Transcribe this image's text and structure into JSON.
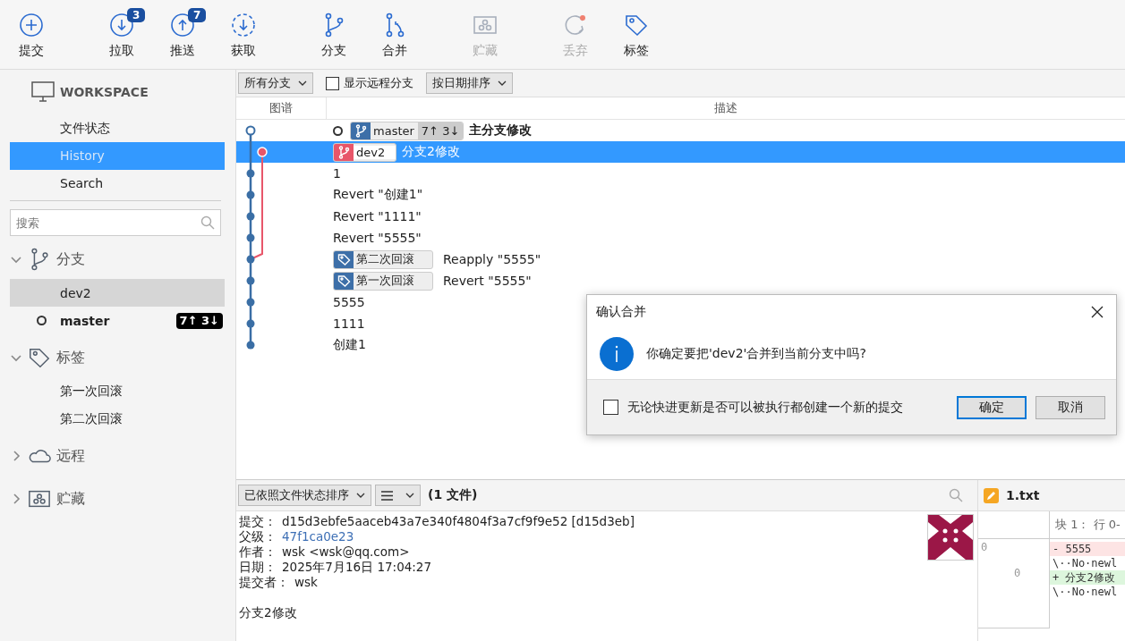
{
  "toolbar": [
    {
      "kind": "plus",
      "label": "提交",
      "disabled": false
    },
    {
      "kind": "pull",
      "label": "拉取",
      "badge": "3",
      "disabled": false
    },
    {
      "kind": "push",
      "label": "推送",
      "badge": "7",
      "disabled": false
    },
    {
      "kind": "fetch",
      "label": "获取",
      "disabled": false
    },
    {
      "kind": "branch",
      "label": "分支",
      "disabled": false
    },
    {
      "kind": "merge",
      "label": "合并",
      "disabled": false
    },
    {
      "kind": "stash",
      "label": "贮藏",
      "disabled": true
    },
    {
      "kind": "discard",
      "label": "丢弃",
      "disabled": true
    },
    {
      "kind": "tag",
      "label": "标签",
      "disabled": false
    }
  ],
  "sidebar": {
    "workspace": {
      "title": "WORKSPACE",
      "items": [
        {
          "label": "文件状态",
          "selected": false
        },
        {
          "label": "History",
          "selected": true
        },
        {
          "label": "Search",
          "selected": false
        }
      ]
    },
    "search": {
      "placeholder": "搜索"
    },
    "sections": [
      {
        "kind": "branch",
        "title": "分支",
        "expanded": true,
        "items": [
          {
            "label": "dev2",
            "selected": true,
            "current": false
          },
          {
            "label": "master",
            "selected": false,
            "current": true,
            "counts": "7↑ 3↓"
          }
        ]
      },
      {
        "kind": "tag",
        "title": "标签",
        "expanded": true,
        "items": [
          {
            "label": "第一次回滚",
            "selected": false,
            "current": false
          },
          {
            "label": "第二次回滚",
            "selected": false,
            "current": false
          }
        ]
      },
      {
        "kind": "cloud",
        "title": "远程",
        "expanded": false
      },
      {
        "kind": "stash",
        "title": "贮藏",
        "expanded": false
      }
    ]
  },
  "history": {
    "filter": {
      "branches": "所有分支",
      "show_remote": {
        "label": "显示远程分支",
        "checked": false
      },
      "sort": "按日期排序"
    },
    "columns": [
      "图谱",
      "描述"
    ],
    "rows": [
      {
        "kind": "hollow",
        "head": true,
        "selected": false,
        "refs": [
          {
            "kind": "branch",
            "label": "master",
            "color": "#3d6fa8",
            "counts": "7↑ 3↓"
          }
        ],
        "message": "主分支修改"
      },
      {
        "kind": "branch-tip",
        "head": false,
        "selected": true,
        "refs": [
          {
            "kind": "branch",
            "label": "dev2",
            "color": "#e8566a"
          }
        ],
        "message": "分支2修改"
      },
      {
        "kind": "dot",
        "head": false,
        "selected": false,
        "refs": [],
        "message": "1"
      },
      {
        "kind": "dot",
        "head": false,
        "selected": false,
        "refs": [],
        "message": "Revert \"创建1\""
      },
      {
        "kind": "dot",
        "head": false,
        "selected": false,
        "refs": [],
        "message": "Revert \"1111\""
      },
      {
        "kind": "dot",
        "head": false,
        "selected": false,
        "refs": [],
        "message": "Revert \"5555\""
      },
      {
        "kind": "fork",
        "head": false,
        "selected": false,
        "refs": [
          {
            "kind": "tag",
            "label": "第二次回滚",
            "color": "#3d6fa8"
          }
        ],
        "message": "Reapply \"5555\""
      },
      {
        "kind": "dot",
        "head": false,
        "selected": false,
        "refs": [
          {
            "kind": "tag",
            "label": "第一次回滚",
            "color": "#3d6fa8"
          }
        ],
        "message": "Revert \"5555\""
      },
      {
        "kind": "dot",
        "head": false,
        "selected": false,
        "refs": [],
        "message": "5555"
      },
      {
        "kind": "dot",
        "head": false,
        "selected": false,
        "refs": [],
        "message": "1111"
      },
      {
        "kind": "dot",
        "head": false,
        "selected": false,
        "refs": [],
        "message": "创建1"
      }
    ]
  },
  "details": {
    "sort": "已依照文件状态排序",
    "file_count": "(1 文件)",
    "fields": [
      {
        "label": "提交：",
        "value": "d15d3ebfe5aaceb43a7e340f4804f3a7cf9f9e52 [d15d3eb]",
        "kind": "text"
      },
      {
        "label": "父级：",
        "value": "47f1ca0e23",
        "kind": "link"
      },
      {
        "label": "作者：",
        "value": "wsk <wsk@qq.com>",
        "kind": "text"
      },
      {
        "label": "日期：",
        "value": "2025年7月16日 17:04:27",
        "kind": "text"
      },
      {
        "label": "提交者：",
        "value": "wsk",
        "kind": "text"
      }
    ],
    "message": "分支2修改"
  },
  "diff": {
    "file": "1.txt",
    "hunk": "块 1： 行 0-",
    "old_line": "0",
    "new_line": "0",
    "lines": [
      {
        "kind": "removed",
        "text": "- 5555"
      },
      {
        "kind": "context",
        "text": "\\··No·newl"
      },
      {
        "kind": "added",
        "text": "+ 分支2修改"
      },
      {
        "kind": "context",
        "text": "\\··No·newl"
      }
    ]
  },
  "dialog": {
    "title": "确认合并",
    "message": "你确定要把'dev2'合并到当前分支中吗?",
    "option": {
      "label": "无论快进更新是否可以被执行都创建一个新的提交",
      "checked": false
    },
    "buttons": [
      {
        "label": "确定",
        "default": true
      },
      {
        "label": "取消",
        "default": false
      }
    ]
  }
}
